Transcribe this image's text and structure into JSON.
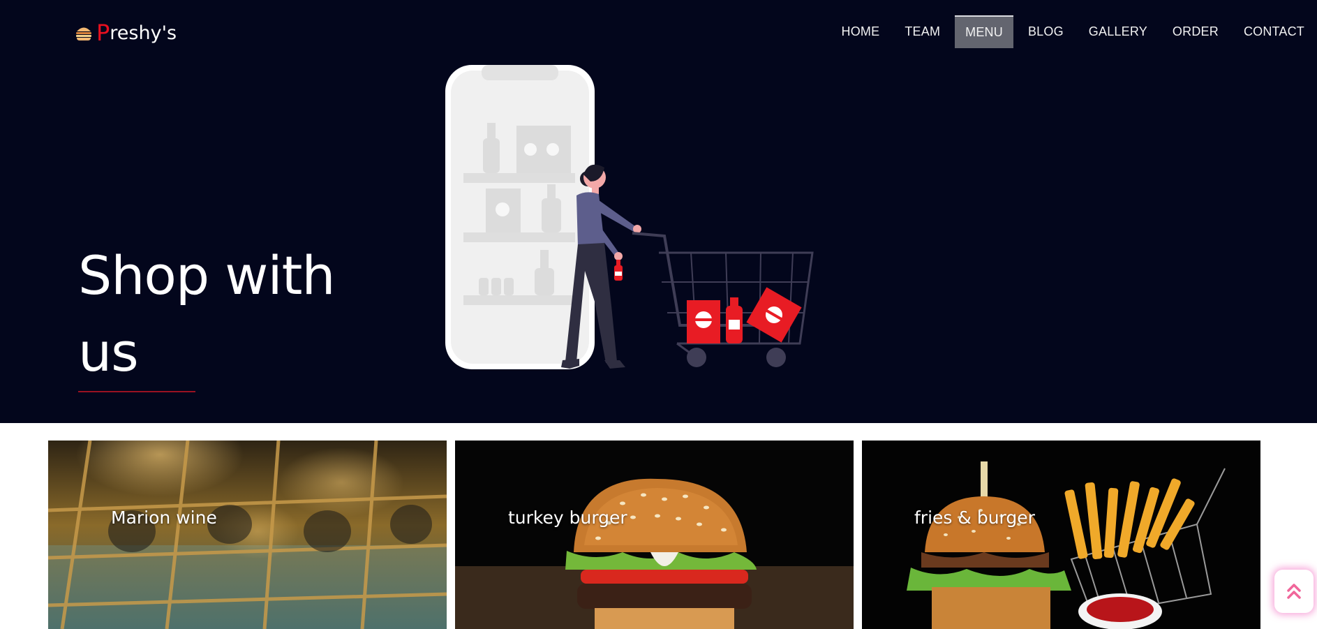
{
  "brand": {
    "initial": "P",
    "rest": "reshy's"
  },
  "nav": {
    "items": [
      {
        "label": "HOME"
      },
      {
        "label": "TEAM"
      },
      {
        "label": "MENU"
      },
      {
        "label": "BLOG"
      },
      {
        "label": "GALLERY"
      },
      {
        "label": "ORDER"
      },
      {
        "label": "CONTACT"
      }
    ],
    "active": "MENU"
  },
  "hero": {
    "title": "Shop with us"
  },
  "cards": [
    {
      "label": "Marion wine"
    },
    {
      "label": "turkey burger"
    },
    {
      "label": "fries & burger"
    }
  ],
  "icons": {
    "logo": "burger-icon",
    "scroll_top": "double-chevron-up-icon"
  },
  "colors": {
    "hero_bg": "#03061c",
    "brand_accent": "#e8101f",
    "nav_active_bg": "#63656f",
    "underline": "#9b1222",
    "scroll_glow": "#f064be"
  }
}
